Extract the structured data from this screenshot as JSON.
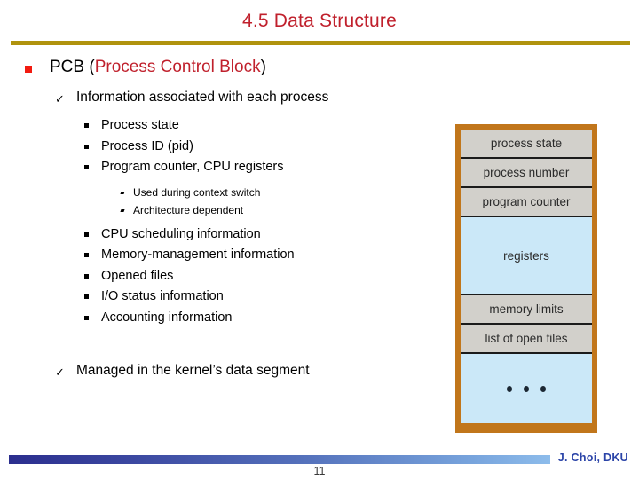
{
  "slide": {
    "title": "4.5 Data Structure",
    "page_number": "11",
    "author": "J. Choi, DKU",
    "accent_title_color": "#C0202C",
    "rule_color": "#B0930E",
    "bullet_color": "#F21B10"
  },
  "outline": {
    "level1": {
      "text_before": "PCB (",
      "text_accent": "Process Control Block",
      "text_after": ")"
    },
    "level2_a": "Information associated with each process",
    "level3_items": [
      "Process state",
      "Process ID (pid)",
      "Program counter, CPU registers"
    ],
    "level4_items": [
      "Used during context switch",
      "Architecture dependent"
    ],
    "level3_items_b": [
      "CPU scheduling information",
      "Memory-management information",
      "Opened files",
      "I/O status information",
      "Accounting information"
    ],
    "level2_b": "Managed in the kernel’s data segment"
  },
  "pcb_diagram": {
    "border_color": "#C1761B",
    "gray_color": "#D2D0CB",
    "blue_color": "#CBE8F8",
    "rows": [
      {
        "label": "process state",
        "style": "gray"
      },
      {
        "label": "process number",
        "style": "gray"
      },
      {
        "label": "program counter",
        "style": "gray"
      },
      {
        "label": "registers",
        "style": "blue"
      },
      {
        "label": "memory limits",
        "style": "gray"
      },
      {
        "label": "list of open files",
        "style": "gray"
      },
      {
        "label": "",
        "style": "blue"
      }
    ]
  }
}
